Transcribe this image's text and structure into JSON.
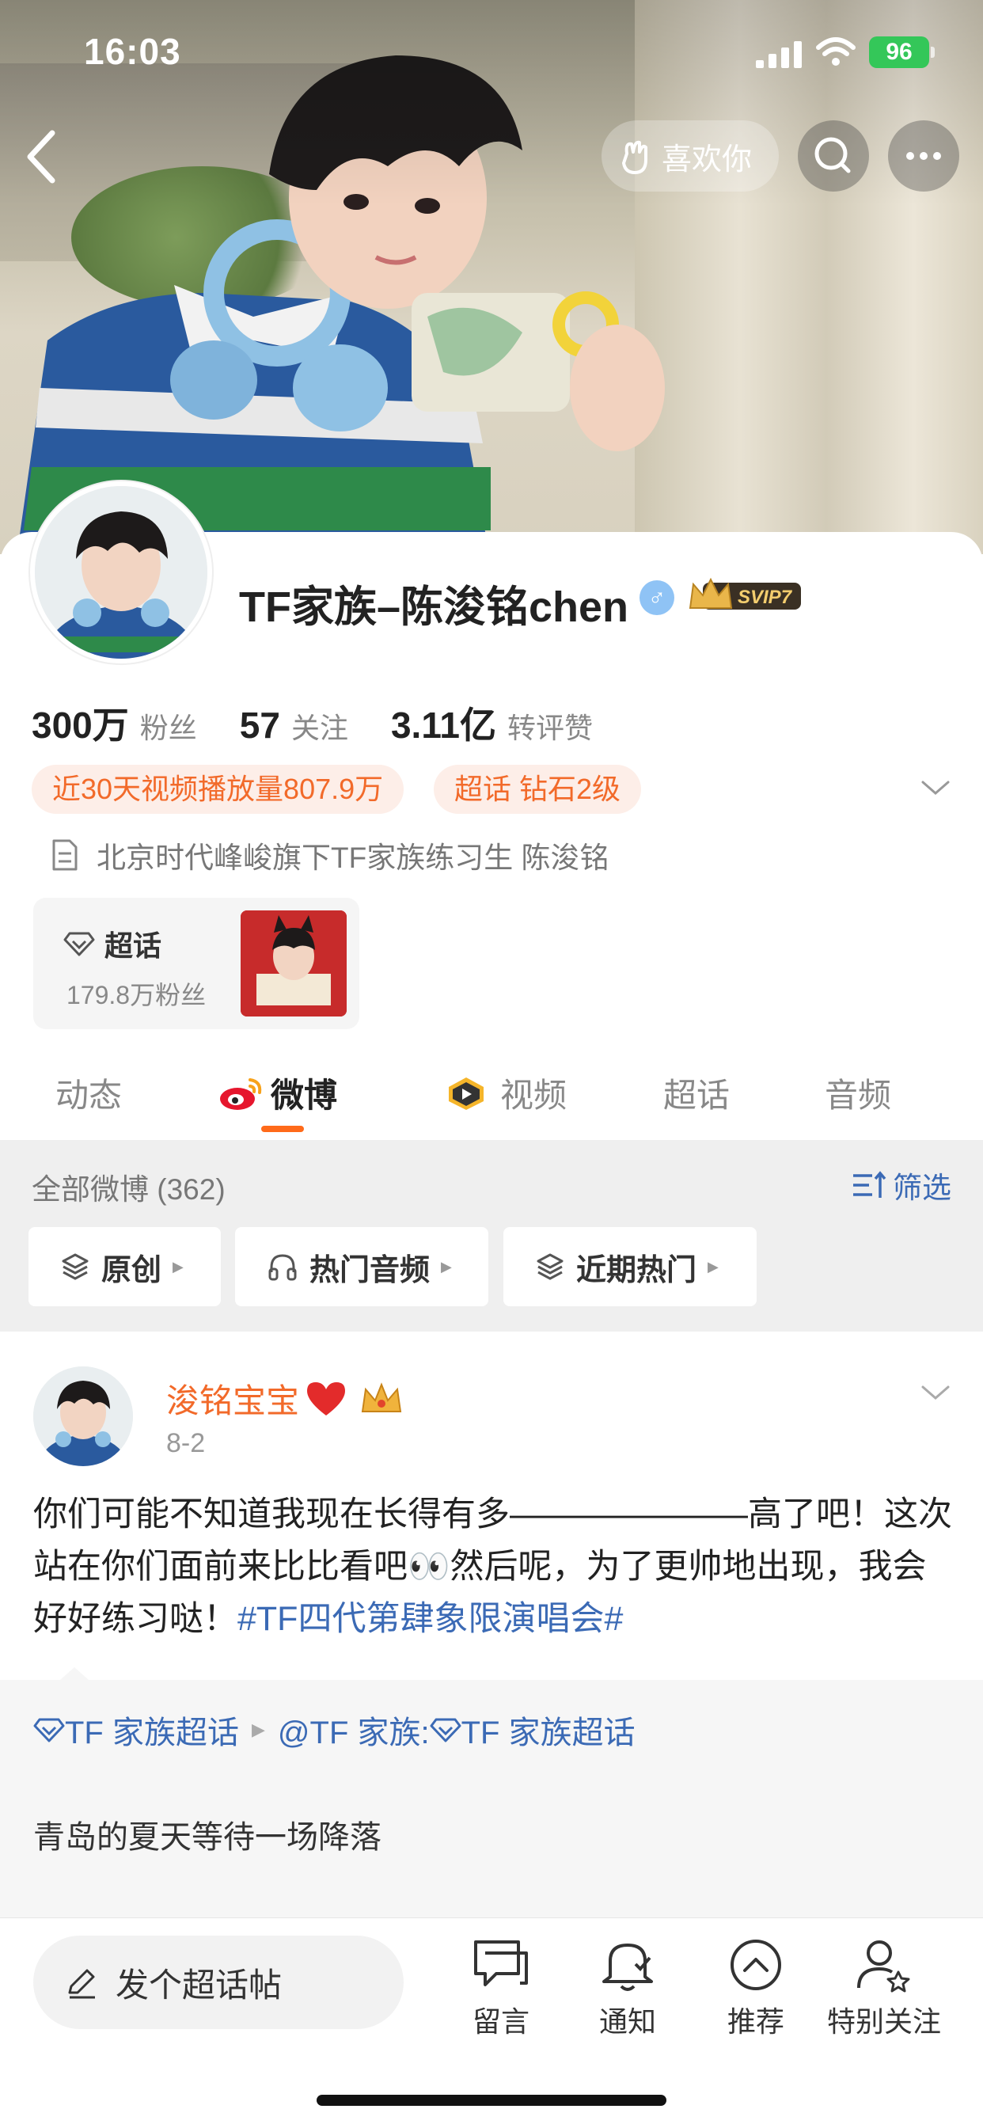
{
  "status_bar": {
    "time": "16:03",
    "battery": "96"
  },
  "top_nav": {
    "like_label": "喜欢你"
  },
  "profile": {
    "name": "TF家族–陈浚铭chen",
    "gender_symbol": "♂",
    "vip_badge": "SVIP7",
    "stats": [
      {
        "value": "300万",
        "label": "粉丝"
      },
      {
        "value": "57",
        "label": "关注"
      },
      {
        "value": "3.11亿",
        "label": "转评赞"
      }
    ],
    "tags": [
      "近30天视频播放量807.9万",
      "超话 钻石2级"
    ],
    "bio": "北京时代峰峻旗下TF家族练习生  陈浚铭"
  },
  "super_topic_card": {
    "title": "超话",
    "fans": "179.8万粉丝"
  },
  "tabs": [
    "动态",
    "微博",
    "视频",
    "超话",
    "音频"
  ],
  "active_tab": "微博",
  "feed_header": {
    "count_label": "全部微博 (362)",
    "filter_label": "筛选"
  },
  "chips": [
    "原创",
    "热门音频",
    "近期热门"
  ],
  "post": {
    "author": "浚铭宝宝",
    "date": "8-2",
    "text_main": "你们可能不知道我现在长得有多———————高了吧！这次站在你们面前来比比看吧👀然后呢，为了更帅地出现，我会好好练习哒！",
    "topic": "#TF四代第肆象限演唱会#"
  },
  "repost": {
    "source": "TF 家族超话",
    "mention": "@TF 家族:",
    "mention_topic": "TF 家族超话",
    "text": "青岛的夏天等待一场降落"
  },
  "bottom_bar": {
    "compose_label": "发个超话帖",
    "items": [
      "留言",
      "通知",
      "推荐",
      "特别关注"
    ]
  }
}
